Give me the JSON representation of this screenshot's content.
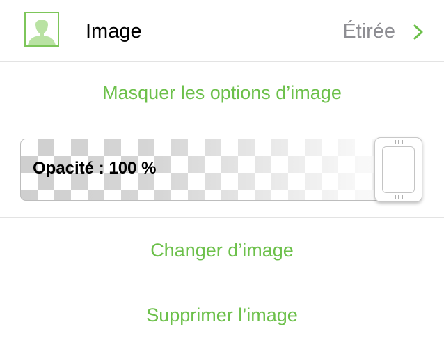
{
  "image_row": {
    "title": "Image",
    "value": "Étirée",
    "thumbnail_icon": "person-silhouette-icon",
    "chevron_icon": "chevron-right-icon"
  },
  "actions": {
    "hide_options": "Masquer les options d’image",
    "change_image": "Changer d’image",
    "delete_image": "Supprimer l’image"
  },
  "opacity": {
    "label": "Opacité : 100 %",
    "value": 1.0
  },
  "colors": {
    "accent": "#6cc04a",
    "secondary_text": "#8e8e93",
    "separator": "#e3e3e3"
  }
}
